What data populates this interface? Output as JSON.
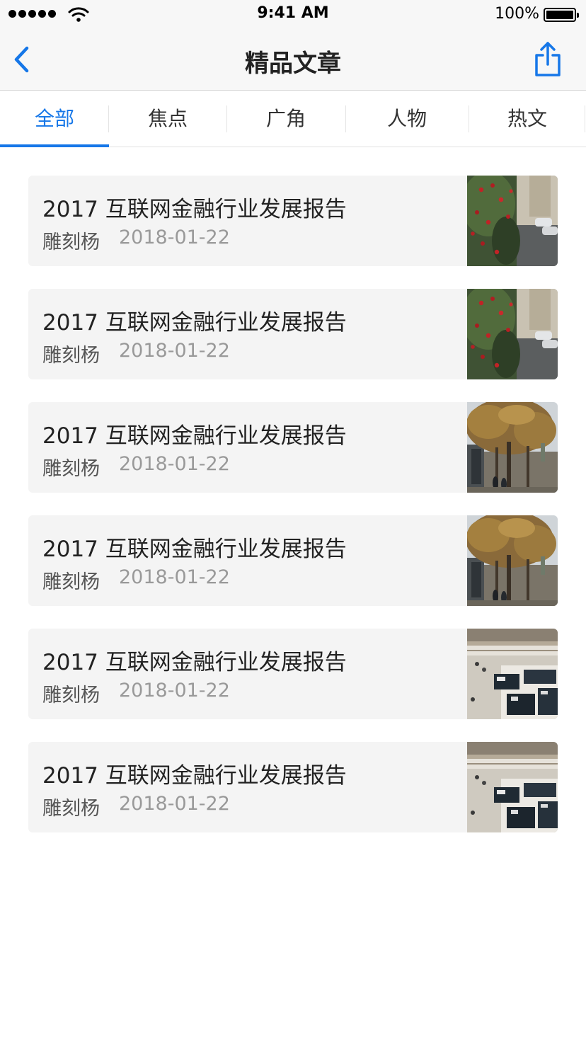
{
  "status_bar": {
    "time": "9:41 AM",
    "battery": "100%"
  },
  "nav": {
    "title": "精品文章",
    "back_icon": "chevron-left-icon",
    "share_icon": "share-icon",
    "accent": "#1677e8"
  },
  "tabs": [
    {
      "label": "全部",
      "active": true
    },
    {
      "label": "焦点"
    },
    {
      "label": "广角"
    },
    {
      "label": "人物"
    },
    {
      "label": "热文"
    }
  ],
  "articles": [
    {
      "title": "2017 互联网金融行业发展报告",
      "author": "雕刻杨",
      "date": "2018-01-22",
      "image": "berries-street-photo"
    },
    {
      "title": "2017 互联网金融行业发展报告",
      "author": "雕刻杨",
      "date": "2018-01-22",
      "image": "berries-street-photo"
    },
    {
      "title": "2017 互联网金融行业发展报告",
      "author": "雕刻杨",
      "date": "2018-01-22",
      "image": "autumn-trees-photo"
    },
    {
      "title": "2017 互联网金融行业发展报告",
      "author": "雕刻杨",
      "date": "2018-01-22",
      "image": "autumn-trees-photo"
    },
    {
      "title": "2017 互联网金融行业发展报告",
      "author": "雕刻杨",
      "date": "2018-01-22",
      "image": "mall-interior-photo"
    },
    {
      "title": "2017 互联网金融行业发展报告",
      "author": "雕刻杨",
      "date": "2018-01-22",
      "image": "mall-interior-photo"
    }
  ]
}
